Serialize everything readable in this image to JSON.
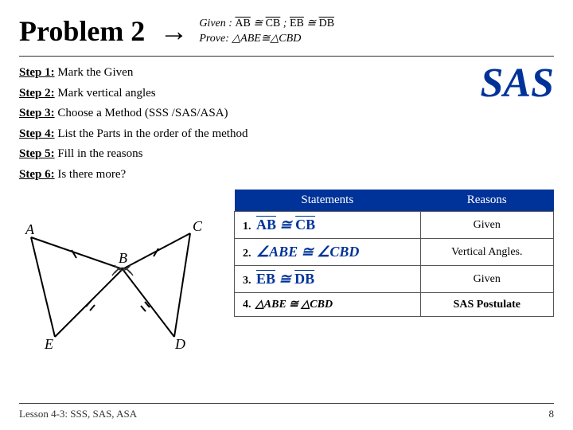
{
  "header": {
    "problem_title": "Problem 2",
    "arrow": "→",
    "given_label": "Given :",
    "given_math": "AB ≅ CB  ;  EB ≅ DB",
    "prove_label": "Prove:",
    "prove_math": "△ABE ≅ △CBD"
  },
  "steps": [
    {
      "num": "Step 1:",
      "text": " Mark the Given"
    },
    {
      "num": "Step 2:",
      "text": " Mark vertical angles"
    },
    {
      "num": "Step 3:",
      "text": " Choose a Method (SSS /SAS/ASA)"
    },
    {
      "num": "Step 4:",
      "text": " List the Parts in the order of the method"
    },
    {
      "num": "Step 5:",
      "text": " Fill in the reasons"
    },
    {
      "num": "Step 6:",
      "text": " Is there more?"
    }
  ],
  "sas_label": "SAS",
  "table": {
    "col_statements": "Statements",
    "col_reasons": "Reasons",
    "rows": [
      {
        "num": "1.",
        "statement": "AB ≅ CB",
        "reason": "Given"
      },
      {
        "num": "2.",
        "statement": "∠ABE ≅ ∠CBD",
        "reason": "Vertical Angles."
      },
      {
        "num": "3.",
        "statement": "EB ≅ DB",
        "reason": "Given"
      },
      {
        "num": "4.",
        "statement": "△ABE ≅ △CBD",
        "reason": "SAS Postulate"
      }
    ]
  },
  "footer": {
    "lesson": "Lesson 4-3: SSS, SAS, ASA",
    "page": "8"
  }
}
